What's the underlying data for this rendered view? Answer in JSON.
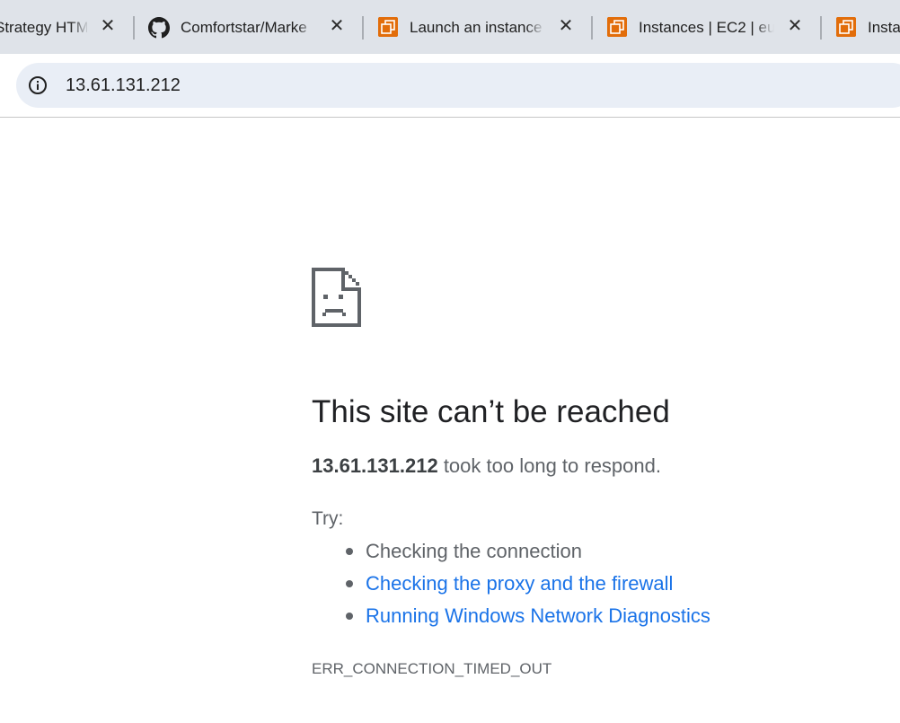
{
  "tabs": [
    {
      "title": "Strategy HTM",
      "icon": "none"
    },
    {
      "title": "Comfortstar/Marke",
      "icon": "github-icon"
    },
    {
      "title": "Launch an instance",
      "icon": "aws-ec2-icon"
    },
    {
      "title": "Instances | EC2 | eu",
      "icon": "aws-ec2-icon"
    },
    {
      "title": "Insta",
      "icon": "aws-ec2-icon"
    }
  ],
  "close_glyph": "✕",
  "omnibox": {
    "url": "13.61.131.212",
    "icon": "info-icon"
  },
  "error": {
    "icon": "sad-page-icon",
    "headline": "This site can’t be reached",
    "host": "13.61.131.212",
    "message_suffix": " took too long to respond.",
    "try_label": "Try:",
    "suggestions": [
      {
        "text": "Checking the connection",
        "is_link": false
      },
      {
        "text": "Checking the proxy and the firewall",
        "is_link": true
      },
      {
        "text": "Running Windows Network Diagnostics",
        "is_link": true
      }
    ],
    "code": "ERR_CONNECTION_TIMED_OUT"
  },
  "colors": {
    "tabstrip_bg": "#dfe3e9",
    "omnibox_bg": "#e9eef6",
    "link": "#1a73e8",
    "text_secondary": "#5f6368",
    "headline": "#202124",
    "aws_orange": "#e26d0a"
  }
}
